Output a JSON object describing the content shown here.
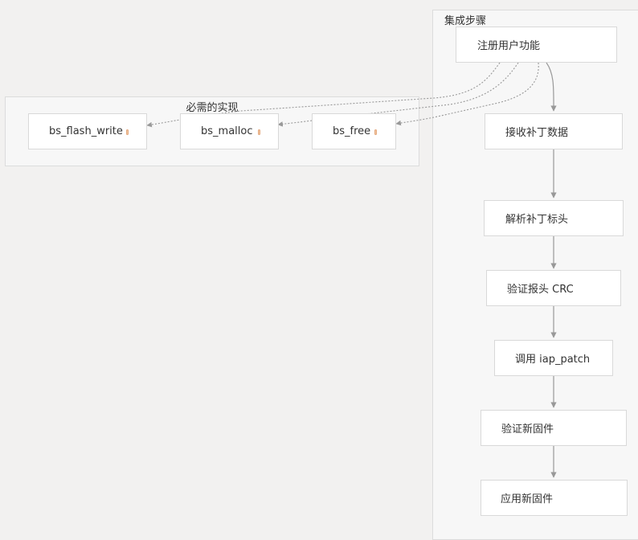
{
  "clusters": {
    "integration_steps": {
      "label": "集成步骤"
    },
    "required_impl": {
      "label": "必需的实现"
    }
  },
  "nodes": {
    "register": "注册用户功能",
    "receive": "接收补丁数据",
    "parse": "解析补丁标头",
    "verify_crc": "验证报头 CRC",
    "call_iap": "调用 iap_patch",
    "verify_fw": "验证新固件",
    "apply_fw": "应用新固件",
    "flash_write": "bs_flash_write",
    "malloc": "bs_malloc",
    "free": "bs_free"
  },
  "colors": {
    "background": "#f2f1f0",
    "cluster_fill": "#f7f7f7",
    "node_fill": "#ffffff",
    "edge": "#999999"
  }
}
